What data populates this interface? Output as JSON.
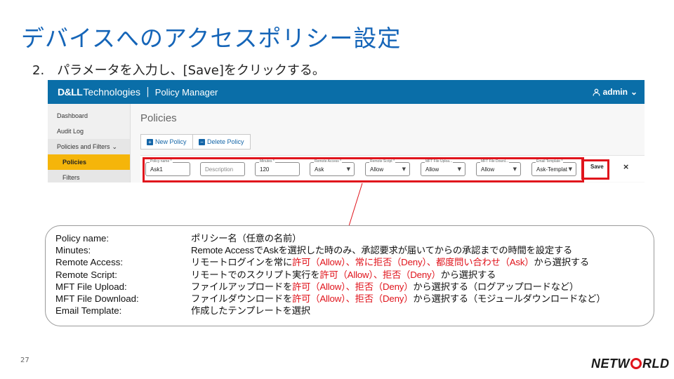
{
  "slide": {
    "title": "デバイスへのアクセスポリシー設定",
    "step_number": "2.",
    "step_text": "パラメータを入力し、[Save]をクリックする。",
    "page_number": "27",
    "company_logo_pre": "NETW",
    "company_logo_post": "RLD"
  },
  "app": {
    "brand_logo": "D&LL",
    "brand_tech": "Technologies",
    "brand_sep": "|",
    "app_name": "Policy Manager",
    "user": "admin",
    "user_icon": "person-icon",
    "sidebar": {
      "items": [
        {
          "label": "Dashboard"
        },
        {
          "label": "Audit Log"
        },
        {
          "label": "Policies and Filters",
          "chevron": "⌄"
        },
        {
          "label": "Policies"
        },
        {
          "label": "Filters"
        }
      ]
    },
    "main": {
      "page_title": "Policies",
      "new_policy_label": "New Policy",
      "delete_policy_label": "Delete Policy",
      "save_label": "Save",
      "close_label": "×",
      "fields": [
        {
          "label": "Policy name *",
          "value": "Ask1"
        },
        {
          "label": "",
          "placeholder": "Description"
        },
        {
          "label": "Minutes *",
          "value": "120"
        },
        {
          "label": "Remote Access *",
          "value": "Ask"
        },
        {
          "label": "Remote Script *",
          "value": "Allow"
        },
        {
          "label": "MFT File Uploa...",
          "value": "Allow"
        },
        {
          "label": "MFT File Downl...",
          "value": "Allow"
        },
        {
          "label": "Email Template *",
          "value": "Ask-Templat"
        }
      ]
    }
  },
  "descriptions": [
    {
      "key": "Policy name:",
      "parts": [
        {
          "t": "ポリシー名（任意の名前）"
        }
      ]
    },
    {
      "key": "Minutes:",
      "parts": [
        {
          "t": "Remote AccessでAskを選択した時のみ、承認要求が届いてからの承認までの時間を設定する"
        }
      ]
    },
    {
      "key": "Remote Access:",
      "parts": [
        {
          "t": "リモートログインを常に"
        },
        {
          "t": "許可（Allow）、常に拒否（Deny）、都度問い合わせ（Ask）",
          "red": true
        },
        {
          "t": "から選択する"
        }
      ]
    },
    {
      "key": "Remote Script:",
      "parts": [
        {
          "t": "リモートでのスクリプト実行を"
        },
        {
          "t": "許可（Allow）、拒否（Deny）",
          "red": true
        },
        {
          "t": "から選択する"
        }
      ]
    },
    {
      "key": "MFT File Upload:",
      "parts": [
        {
          "t": "ファイルアップロードを"
        },
        {
          "t": "許可（Allow）、拒否（Deny）",
          "red": true
        },
        {
          "t": "から選択する（ログアップロードなど）"
        }
      ]
    },
    {
      "key": "MFT File Download:",
      "parts": [
        {
          "t": "ファイルダウンロードを"
        },
        {
          "t": "許可（Allow）、拒否（Deny）",
          "red": true
        },
        {
          "t": "から選択する（モジュールダウンロードなど）"
        }
      ]
    },
    {
      "key": "Email Template:",
      "parts": [
        {
          "t": "作成したテンプレートを選択"
        }
      ]
    }
  ],
  "colors": {
    "title": "#1565b8",
    "header": "#0a6ea8",
    "highlight": "#e0141c",
    "active": "#f5b50a"
  }
}
